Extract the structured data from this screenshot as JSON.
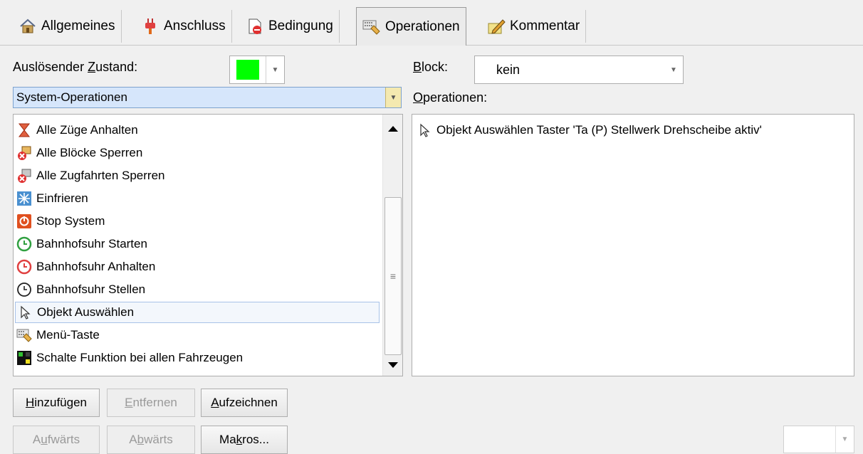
{
  "tabs": [
    {
      "label": "Allgemeines",
      "icon": "house-icon"
    },
    {
      "label": "Anschluss",
      "icon": "plug-icon"
    },
    {
      "label": "Bedingung",
      "icon": "condition-icon"
    },
    {
      "label": "Operationen",
      "icon": "keyboard-icon",
      "active": true
    },
    {
      "label": "Kommentar",
      "icon": "pencil-note-icon"
    }
  ],
  "trigger_state": {
    "label_pre": "Auslösender ",
    "label_accel": "Z",
    "label_post": "ustand:",
    "color": "#00ff00"
  },
  "block": {
    "label_accel": "B",
    "label_post": "lock:",
    "value": "kein"
  },
  "category_select": {
    "value": "System-Operationen"
  },
  "operations_label": {
    "label_accel": "O",
    "label_post": "perationen:"
  },
  "available_ops": [
    {
      "label": "Alle Züge Anhalten",
      "icon": "stop-trains-icon"
    },
    {
      "label": "Alle Blöcke Sperren",
      "icon": "lock-blocks-icon"
    },
    {
      "label": "Alle Zugfahrten Sperren",
      "icon": "lock-routes-icon"
    },
    {
      "label": "Einfrieren",
      "icon": "freeze-icon"
    },
    {
      "label": "Stop System",
      "icon": "power-stop-icon"
    },
    {
      "label": "Bahnhofsuhr Starten",
      "icon": "clock-start-icon"
    },
    {
      "label": "Bahnhofsuhr Anhalten",
      "icon": "clock-stop-icon"
    },
    {
      "label": "Bahnhofsuhr Stellen",
      "icon": "clock-set-icon"
    },
    {
      "label": "Objekt Auswählen",
      "icon": "cursor-icon",
      "selected": true
    },
    {
      "label": "Menü-Taste",
      "icon": "keyboard-icon"
    },
    {
      "label": "Schalte Funktion bei allen Fahrzeugen",
      "icon": "function-switch-icon"
    }
  ],
  "operations": [
    {
      "label": "Objekt Auswählen Taster 'Ta (P) Stellwerk Drehscheibe aktiv'",
      "icon": "cursor-icon"
    }
  ],
  "buttons": {
    "add": {
      "accel": "H",
      "rest": "inzufügen"
    },
    "remove": {
      "accel": "E",
      "rest": "ntfernen"
    },
    "record": {
      "accel": "A",
      "rest": "ufzeichnen"
    },
    "up": {
      "pre": "A",
      "accel": "u",
      "rest": "fwärts"
    },
    "down": {
      "pre": "A",
      "accel": "b",
      "rest": "wärts"
    },
    "macros": {
      "pre": "Ma",
      "accel": "k",
      "rest": "ros..."
    }
  },
  "colors": {
    "accent_selection": "#a8c2e8",
    "category_bg": "#d6e6fb",
    "trigger_color": "#00ff00"
  }
}
